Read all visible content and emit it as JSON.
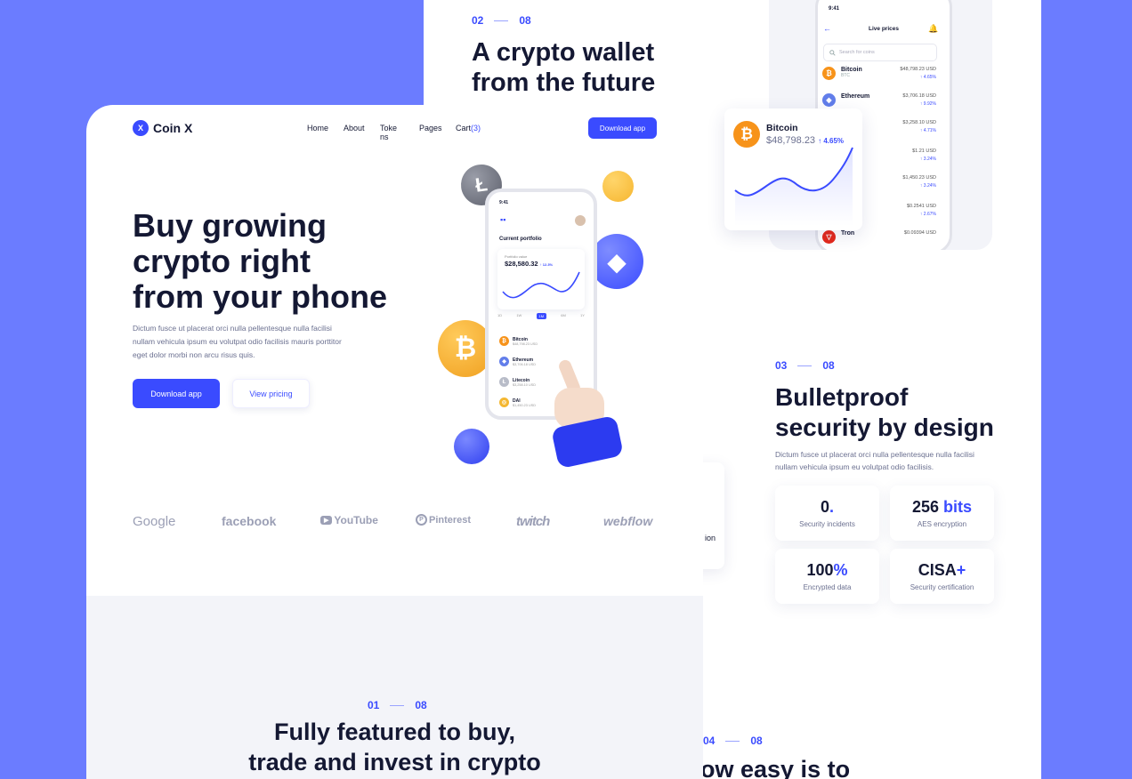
{
  "section2": {
    "step_from": "02",
    "step_to": "08",
    "title_l1": "A crypto wallet",
    "title_l2": "from the future"
  },
  "live_prices": {
    "time": "9:41",
    "title": "Live prices",
    "search_placeholder": "Search for coins",
    "rows": [
      {
        "name": "Bitcoin",
        "sub": "BTC",
        "price": "$48,798.23 USD",
        "change": "↑ 4.65%",
        "color": "#f7931a",
        "glyph": "₿"
      },
      {
        "name": "Ethereum",
        "sub": "",
        "price": "$3,706.18 USD",
        "change": "↑ 9.92%",
        "color": "#627eea",
        "glyph": "◆"
      },
      {
        "name": "",
        "sub": "",
        "price": "$3,258.10 USD",
        "change": "↑ 4.71%",
        "color": "#c0c4d4",
        "glyph": ""
      },
      {
        "name": "",
        "sub": "",
        "price": "$1.21 USD",
        "change": "↑ 3.24%",
        "color": "#c0c4d4",
        "glyph": ""
      },
      {
        "name": "",
        "sub": "",
        "price": "$1,450.23 USD",
        "change": "↑ 3.24%",
        "color": "#c0c4d4",
        "glyph": ""
      },
      {
        "name": "",
        "sub": "",
        "price": "$0.2541 USD",
        "change": "↑ 2.67%",
        "color": "#c0c4d4",
        "glyph": ""
      },
      {
        "name": "Tron",
        "sub": "",
        "price": "$0.09394 USD",
        "change": "",
        "color": "#e5281a",
        "glyph": "▽"
      }
    ]
  },
  "btc_card": {
    "name": "Bitcoin",
    "price": "$48,798.23",
    "change": "↑ 4.65%",
    "glyph": "₿"
  },
  "header": {
    "brand": "Coin X",
    "brand_mark": "X",
    "nav": [
      "Home",
      "About",
      "Tokens",
      "Pages",
      "Cart"
    ],
    "cart_count": "(3)",
    "cta": "Download app"
  },
  "hero": {
    "title_l1": "Buy growing",
    "title_l2": "crypto right",
    "title_l3": "from your phone",
    "para_l1": "Dictum fusce ut placerat orci nulla pellentesque nulla facilisi",
    "para_l2": "nullam vehicula ipsum eu volutpat odio facilisis mauris porttitor",
    "para_l3": "eget dolor morbi non arcu risus quis.",
    "btn_primary": "Download app",
    "btn_secondary": "View pricing"
  },
  "phone": {
    "time": "9:41",
    "title": "Current portfolio",
    "balance_label": "Portfolio value",
    "balance": "$28,580.32",
    "balance_change": "↑ 12.3%",
    "ranges": [
      "1D",
      "1W",
      "1M",
      "6M",
      "1Y"
    ],
    "active_range": "1M",
    "coins": [
      {
        "name": "Bitcoin",
        "value": "$48,798.23 USD",
        "color": "#f7931a",
        "glyph": "₿"
      },
      {
        "name": "Ethereum",
        "value": "$3,706.18 USD",
        "color": "#627eea",
        "glyph": "◆"
      },
      {
        "name": "Litecoin",
        "value": "$3,258.10 USD",
        "color": "#b8bcc8",
        "glyph": "Ł"
      },
      {
        "name": "DAI",
        "value": "$1,450.23 USD",
        "color": "#f4b731",
        "glyph": "◎"
      }
    ]
  },
  "logos": [
    "Google",
    "facebook",
    "YouTube",
    "Pinterest",
    "twitch",
    "webflow"
  ],
  "section1": {
    "step_from": "01",
    "step_to": "08",
    "title_l1": "Fully featured to buy,",
    "title_l2": "trade and invest in crypto"
  },
  "section3": {
    "step_from": "03",
    "step_to": "08",
    "title_l1": "Bulletproof",
    "title_l2": "security by design",
    "para_l1": "Dictum fusce ut placerat orci nulla pellentesque nulla facilisi",
    "para_l2": "nullam vehicula ipsum eu volutpat odio facilisis.",
    "stats": [
      {
        "value": "0",
        "accent": ".",
        "label": "Security incidents"
      },
      {
        "value": "256 ",
        "accent": "bits",
        "label": "AES encryption"
      },
      {
        "value": "100",
        "accent": "%",
        "label": "Encrypted data"
      },
      {
        "value": "CISA",
        "accent": "+",
        "label": "Security certification"
      }
    ]
  },
  "partial_card": {
    "text": "ion"
  },
  "section4": {
    "step_from": "04",
    "step_to": "08",
    "title_l1": "ow easy is to"
  },
  "colors": {
    "accent": "#3a4bff",
    "background": "#6b7cff",
    "ink": "#141833"
  }
}
